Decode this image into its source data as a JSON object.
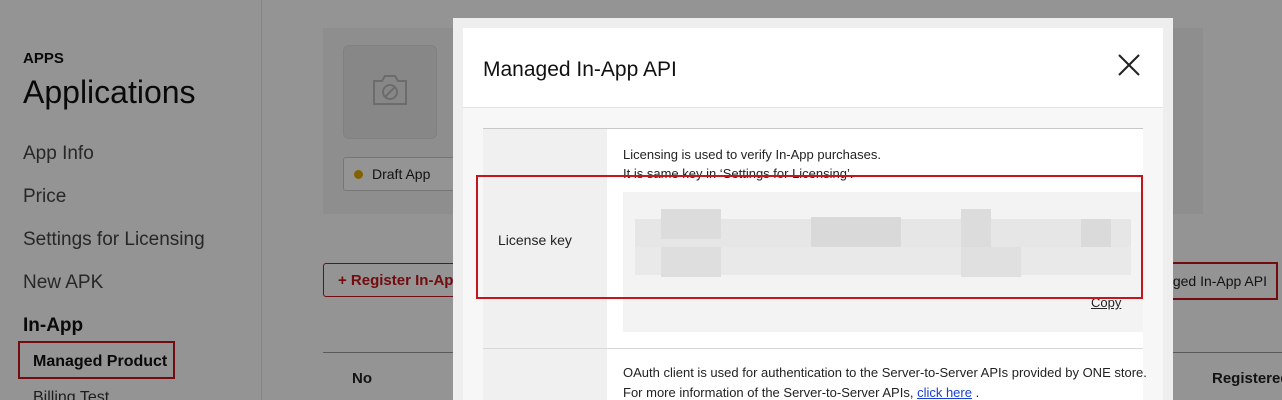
{
  "sidebar": {
    "section_label": "APPS",
    "title": "Applications",
    "items": [
      {
        "label": "App Info"
      },
      {
        "label": "Price"
      },
      {
        "label": "Settings for Licensing"
      },
      {
        "label": "New APK"
      },
      {
        "label": "In-App"
      }
    ],
    "sub_items": [
      {
        "label": "Managed Product"
      },
      {
        "label": "Billing Test"
      }
    ]
  },
  "main": {
    "status_badge": "Draft App",
    "register_button": "+ Register In-App",
    "api_button": "Managed In-App API",
    "table_headers": [
      "No",
      "Registered"
    ]
  },
  "modal": {
    "title": "Managed In-App API",
    "rows": [
      {
        "label": "License key",
        "desc_line1": "Licensing is used to verify In-App purchases.",
        "desc_line2": "It is same key in ‘Settings for Licensing’.",
        "copy_label": "Copy"
      },
      {
        "desc_line1": "OAuth client is used for authentication to the Server-to-Server APIs provided by ONE store.",
        "desc_line2_prefix": "For more information of the Server-to-Server APIs, ",
        "link_text": "click here",
        "desc_line2_suffix": " ."
      }
    ]
  },
  "colors": {
    "accent_red": "#c4161c",
    "overlay": "rgba(0,0,0,0.42)",
    "draft_dot": "#e0a800"
  }
}
